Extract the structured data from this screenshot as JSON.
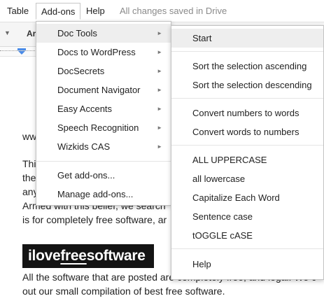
{
  "menubar": {
    "table": "Table",
    "addons": "Add-ons",
    "help": "Help",
    "status": "All changes saved in Drive"
  },
  "toolbar": {
    "font_partial": "Ar"
  },
  "addons_menu": {
    "items": [
      {
        "label": "Doc Tools",
        "has_submenu": true,
        "active": true
      },
      {
        "label": "Docs to WordPress",
        "has_submenu": true
      },
      {
        "label": "DocSecrets",
        "has_submenu": true
      },
      {
        "label": "Document Navigator",
        "has_submenu": true
      },
      {
        "label": "Easy Accents",
        "has_submenu": true
      },
      {
        "label": "Speech Recognition",
        "has_submenu": true
      },
      {
        "label": "Wizkids CAS",
        "has_submenu": true
      }
    ],
    "footer": [
      {
        "label": "Get add-ons..."
      },
      {
        "label": "Manage add-ons..."
      }
    ],
    "arrow_glyph": "►"
  },
  "doc_tools_submenu": {
    "start": "Start",
    "sort_ascending": "Sort the selection ascending",
    "sort_descending": "Sort the selection descending",
    "convert_numbers": "Convert numbers to words",
    "convert_words": "Convert words to numbers",
    "uppercase": "ALL UPPERCASE",
    "lowercase": "all lowercase",
    "capitalize": "Capitalize Each Word",
    "sentence_case": "Sentence case",
    "toggle_case": "tOGGLE cASE",
    "help": "Help"
  },
  "document": {
    "line1": "ww",
    "line2": "Thi",
    "line3": "the",
    "line4": "any",
    "line5": "Armed with this belief, we search",
    "line6": "is for completely free software, ar",
    "logo": {
      "pre": "ilove",
      "mid": "free",
      "post": "software"
    },
    "line7": "All the software that are posted are completely free, and legal. We c",
    "line8": "out our small compilation of best free software."
  }
}
